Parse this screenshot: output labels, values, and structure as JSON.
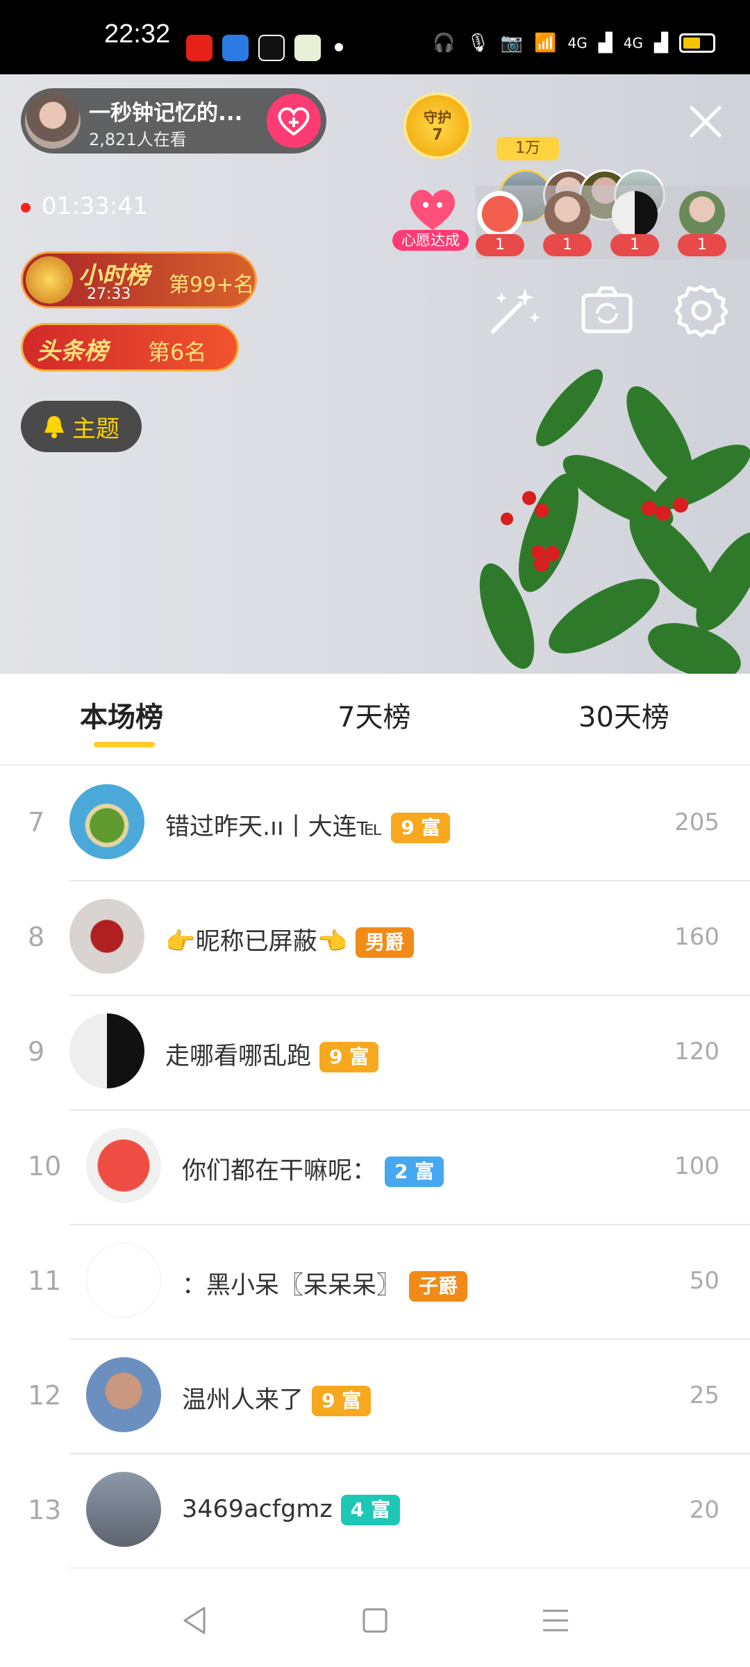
{
  "status_bar": {
    "time": "22:32",
    "signal_label_1": "4G",
    "signal_label_2": "4G",
    "icons": [
      "youtube-icon",
      "edge-icon",
      "tiktok-icon",
      "app-icon",
      "headphones-icon",
      "mic-icon",
      "camera-icon",
      "wifi-icon",
      "signal-icon",
      "battery-icon"
    ],
    "battery_color": "#f6c500"
  },
  "live": {
    "anchor_name": "一秒钟记忆的...",
    "viewers": "2,821人在看",
    "follow_color": "#ff3b73",
    "guard_label": "守护",
    "guard_count": "7",
    "fans_badge": "1万",
    "timer": "01:33:41",
    "wish_label": "心愿达成",
    "rank_users": [
      {
        "count": "1"
      },
      {
        "count": "1"
      },
      {
        "count": "1"
      },
      {
        "count": "1"
      }
    ],
    "hour_rank_title": "小时榜",
    "hour_rank_time": "27:33",
    "hour_rank_place": "第99+名",
    "top_rank_title": "头条榜",
    "top_rank_place": "第6名",
    "theme_label": "主题"
  },
  "tabs": [
    {
      "label": "本场榜"
    },
    {
      "label": "7天榜"
    },
    {
      "label": "30天榜"
    }
  ],
  "list": [
    {
      "rank": "7",
      "nick": "错过昨天.ıı丨大连℡",
      "badge": "9 富",
      "badge_color": "#f7a81f",
      "score": "205"
    },
    {
      "rank": "8",
      "nick": "👉昵称已屏蔽👈",
      "badge": "男爵",
      "badge_color": "#f28a18",
      "score": "160"
    },
    {
      "rank": "9",
      "nick": "走哪看哪乱跑",
      "badge": "9 富",
      "badge_color": "#f7a81f",
      "score": "120"
    },
    {
      "rank": "10",
      "nick": "你们都在干嘛呢：",
      "badge": "2 富",
      "badge_color": "#46a8f0",
      "score": "100"
    },
    {
      "rank": "11",
      "nick": "：黑小呆〖呆呆呆〗",
      "badge": "子爵",
      "badge_color": "#f28a18",
      "score": "50"
    },
    {
      "rank": "12",
      "nick": "温州人来了",
      "badge": "9 富",
      "badge_color": "#f7a81f",
      "score": "25"
    },
    {
      "rank": "13",
      "nick": "3469acfgmz",
      "badge": "4 富",
      "badge_color": "#1cc7b6",
      "score": "20"
    }
  ]
}
